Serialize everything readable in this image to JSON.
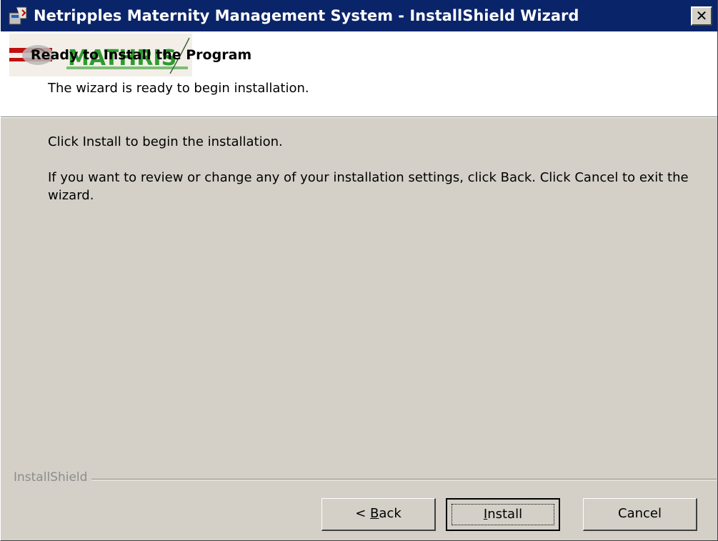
{
  "window": {
    "title": "Netripples Maternity Management System - InstallShield Wizard",
    "close_glyph": "✕"
  },
  "header": {
    "title": "Ready to Install the Program",
    "subtitle": "The wizard is ready to begin installation.",
    "banner_text": "MATHRIS"
  },
  "body": {
    "paragraph1": "Click Install to begin the installation.",
    "paragraph2": "If you want to review or change any of your installation settings, click Back. Click Cancel to exit the wizard."
  },
  "footer": {
    "brand": "InstallShield",
    "buttons": {
      "back_prefix": "< ",
      "back_mnemonic": "B",
      "back_rest": "ack",
      "install_mnemonic": "I",
      "install_rest": "nstall",
      "cancel": "Cancel"
    }
  },
  "colors": {
    "titlebar": "#0a246a",
    "face": "#d4d0c8",
    "header_bg": "#ffffff"
  },
  "icons": [
    "installer-icon",
    "close-icon",
    "banner-logo"
  ]
}
